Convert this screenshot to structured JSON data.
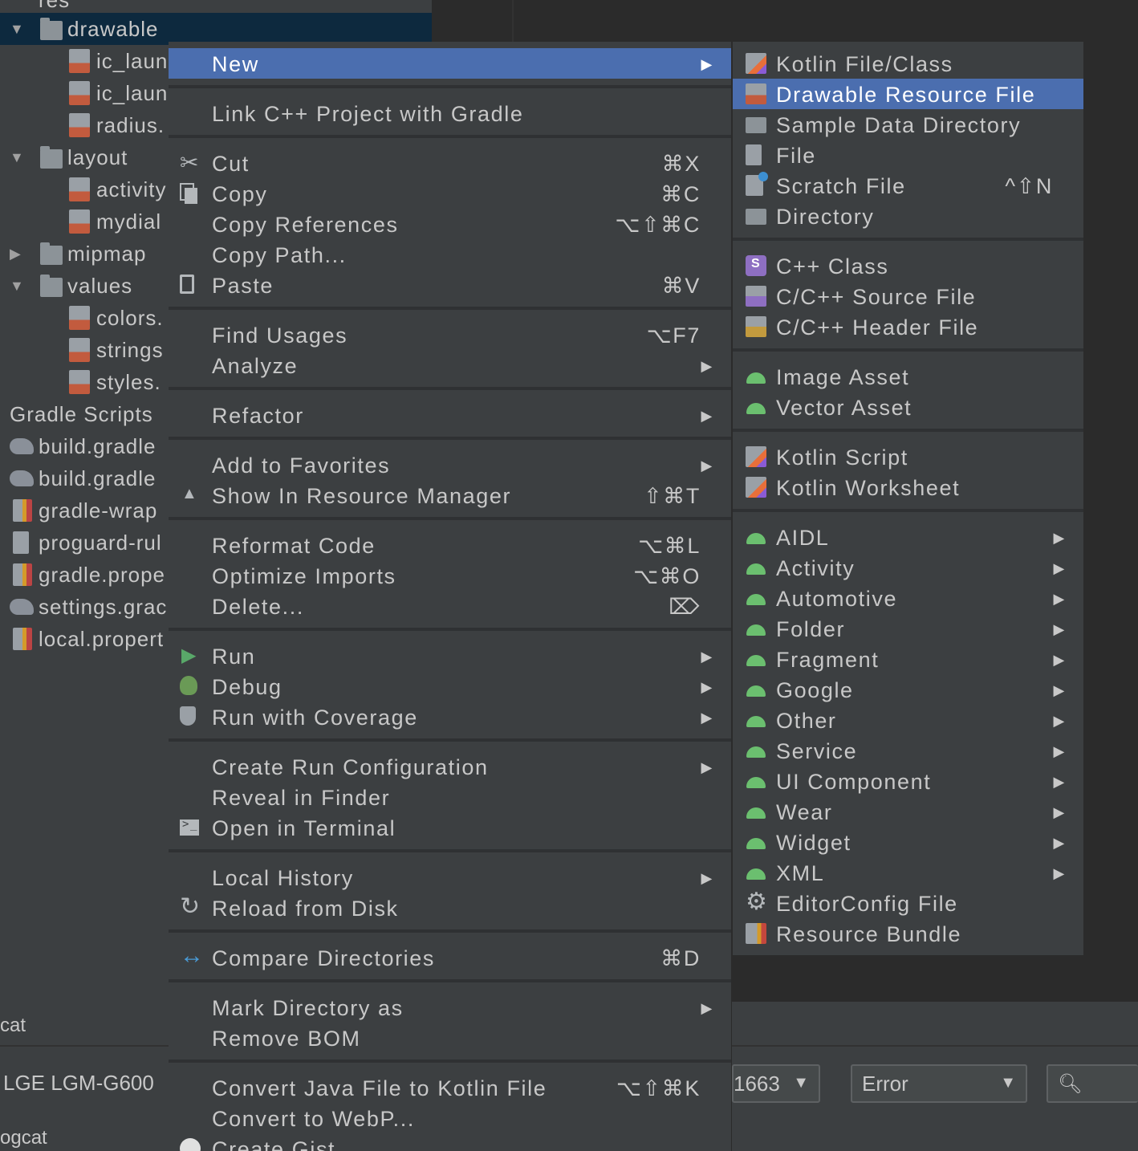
{
  "tree": {
    "items": [
      {
        "label": "res",
        "kind": "folder"
      },
      {
        "label": "drawable",
        "kind": "folder",
        "expanded": true,
        "selected": true
      },
      {
        "label": "ic_laun",
        "kind": "xml"
      },
      {
        "label": "ic_laun",
        "kind": "xml"
      },
      {
        "label": "radius.",
        "kind": "xml"
      },
      {
        "label": "layout",
        "kind": "folder",
        "expanded": true
      },
      {
        "label": "activity",
        "kind": "xml"
      },
      {
        "label": "mydial",
        "kind": "xml"
      },
      {
        "label": "mipmap",
        "kind": "folder",
        "expanded": false
      },
      {
        "label": "values",
        "kind": "folder",
        "expanded": true
      },
      {
        "label": "colors.",
        "kind": "xml"
      },
      {
        "label": "strings",
        "kind": "xml"
      },
      {
        "label": "styles.",
        "kind": "xml"
      },
      {
        "label": "Gradle Scripts",
        "kind": "group"
      },
      {
        "label": "build.gradle",
        "kind": "gradle"
      },
      {
        "label": "build.gradle",
        "kind": "gradle"
      },
      {
        "label": "gradle-wrap",
        "kind": "properties"
      },
      {
        "label": "proguard-rul",
        "kind": "file"
      },
      {
        "label": "gradle.prope",
        "kind": "properties"
      },
      {
        "label": "settings.grac",
        "kind": "gradle"
      },
      {
        "label": "local.propert",
        "kind": "properties"
      }
    ]
  },
  "context_menu": {
    "items": [
      {
        "label": "New",
        "highlighted": true,
        "submenu": true
      },
      {
        "label": "Link C++ Project with Gradle"
      },
      {
        "label": "Cut",
        "shortcut": "⌘X",
        "icon": "scissors-icon"
      },
      {
        "label": "Copy",
        "shortcut": "⌘C",
        "icon": "copy-icon"
      },
      {
        "label": "Copy References",
        "shortcut": "⌥⇧⌘C"
      },
      {
        "label": "Copy Path..."
      },
      {
        "label": "Paste",
        "shortcut": "⌘V",
        "icon": "paste-icon"
      },
      {
        "label": "Find Usages",
        "shortcut": "⌥F7"
      },
      {
        "label": "Analyze",
        "submenu": true
      },
      {
        "label": "Refactor",
        "submenu": true
      },
      {
        "label": "Add to Favorites",
        "submenu": true
      },
      {
        "label": "Show In Resource Manager",
        "shortcut": "⇧⌘T",
        "icon": "resource-manager-icon"
      },
      {
        "label": "Reformat Code",
        "shortcut": "⌥⌘L"
      },
      {
        "label": "Optimize Imports",
        "shortcut": "⌥⌘O"
      },
      {
        "label": "Delete...",
        "shortcut": "⌦"
      },
      {
        "label": "Run",
        "submenu": true,
        "icon": "run-icon"
      },
      {
        "label": "Debug",
        "submenu": true,
        "icon": "debug-icon"
      },
      {
        "label": "Run with Coverage",
        "submenu": true,
        "icon": "coverage-icon"
      },
      {
        "label": "Create Run Configuration",
        "submenu": true
      },
      {
        "label": "Reveal in Finder"
      },
      {
        "label": "Open in Terminal",
        "icon": "terminal-icon"
      },
      {
        "label": "Local History",
        "submenu": true
      },
      {
        "label": "Reload from Disk",
        "icon": "reload-icon"
      },
      {
        "label": "Compare Directories",
        "shortcut": "⌘D",
        "icon": "compare-icon"
      },
      {
        "label": "Mark Directory as",
        "submenu": true
      },
      {
        "label": "Remove BOM"
      },
      {
        "label": "Convert Java File to Kotlin File",
        "shortcut": "⌥⇧⌘K"
      },
      {
        "label": "Convert to WebP..."
      },
      {
        "label": "Create Gist",
        "icon": "github-icon"
      }
    ]
  },
  "new_submenu": {
    "items": [
      {
        "label": "Kotlin File/Class",
        "icon": "kotlin-icon"
      },
      {
        "label": "Drawable Resource File",
        "icon": "drawable-icon",
        "highlighted": true
      },
      {
        "label": "Sample Data Directory",
        "icon": "folder-icon"
      },
      {
        "label": "File",
        "icon": "file-icon"
      },
      {
        "label": "Scratch File",
        "shortcut": "^⇧N",
        "icon": "scratch-icon"
      },
      {
        "label": "Directory",
        "icon": "folder-icon"
      },
      {
        "label": "C++ Class",
        "icon": "cpp-class-icon"
      },
      {
        "label": "C/C++ Source File",
        "icon": "cpp-source-icon"
      },
      {
        "label": "C/C++ Header File",
        "icon": "cpp-header-icon"
      },
      {
        "label": "Image Asset",
        "icon": "android-icon"
      },
      {
        "label": "Vector Asset",
        "icon": "android-icon"
      },
      {
        "label": "Kotlin Script",
        "icon": "kotlin-icon"
      },
      {
        "label": "Kotlin Worksheet",
        "icon": "kotlin-icon"
      },
      {
        "label": "AIDL",
        "icon": "android-icon",
        "submenu": true
      },
      {
        "label": "Activity",
        "icon": "android-icon",
        "submenu": true
      },
      {
        "label": "Automotive",
        "icon": "android-icon",
        "submenu": true
      },
      {
        "label": "Folder",
        "icon": "android-icon",
        "submenu": true
      },
      {
        "label": "Fragment",
        "icon": "android-icon",
        "submenu": true
      },
      {
        "label": "Google",
        "icon": "android-icon",
        "submenu": true
      },
      {
        "label": "Other",
        "icon": "android-icon",
        "submenu": true
      },
      {
        "label": "Service",
        "icon": "android-icon",
        "submenu": true
      },
      {
        "label": "UI Component",
        "icon": "android-icon",
        "submenu": true
      },
      {
        "label": "Wear",
        "icon": "android-icon",
        "submenu": true
      },
      {
        "label": "Widget",
        "icon": "android-icon",
        "submenu": true
      },
      {
        "label": "XML",
        "icon": "android-icon",
        "submenu": true
      },
      {
        "label": "EditorConfig File",
        "icon": "gear-icon"
      },
      {
        "label": "Resource Bundle",
        "icon": "bundle-icon"
      }
    ]
  },
  "logcat": {
    "tab_label": "cat",
    "device": "LGE LGM-G600",
    "process": "1663",
    "level": "Error",
    "footer_label": "ogcat"
  },
  "colors": {
    "menu_bg": "#3c3f41",
    "highlight": "#4b6eaf",
    "editor_bg": "#2b2b2b"
  }
}
